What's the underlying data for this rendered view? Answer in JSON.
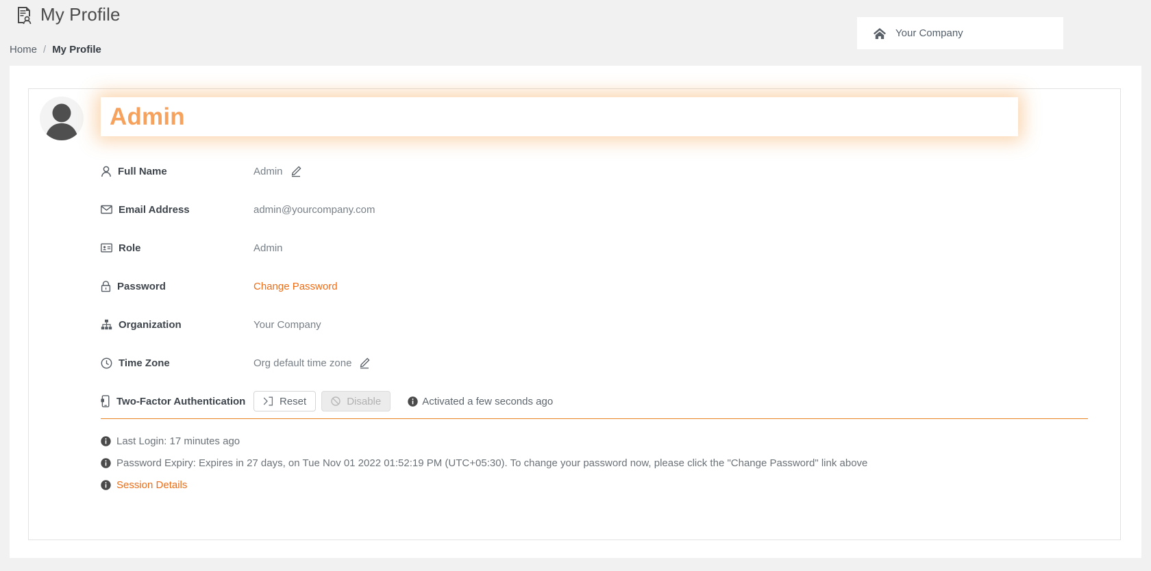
{
  "header": {
    "title": "My Profile",
    "icon": "document-user-icon"
  },
  "breadcrumb": {
    "home": "Home",
    "separator": "/",
    "current": "My Profile"
  },
  "company_badge": {
    "icon": "home-icon",
    "name": "Your Company"
  },
  "profile": {
    "avatar_icon": "user-avatar-icon",
    "display_name": "Admin",
    "fields": [
      {
        "icon": "person-icon",
        "label": "Full Name",
        "value": "Admin",
        "editable": true,
        "link": false
      },
      {
        "icon": "envelope-icon",
        "label": "Email Address",
        "value": "admin@yourcompany.com",
        "editable": false,
        "link": false
      },
      {
        "icon": "id-badge-icon",
        "label": "Role",
        "value": "Admin",
        "editable": false,
        "link": false
      },
      {
        "icon": "lock-icon",
        "label": "Password",
        "value": "Change Password",
        "editable": false,
        "link": true
      },
      {
        "icon": "sitemap-icon",
        "label": "Organization",
        "value": "Your Company",
        "editable": false,
        "link": false
      },
      {
        "icon": "clock-icon",
        "label": "Time Zone",
        "value": "Org default time zone",
        "editable": true,
        "link": false
      }
    ],
    "two_factor": {
      "icon": "mobile-lock-icon",
      "label": "Two-Factor Authentication",
      "reset_button": {
        "label": "Reset",
        "icon": "sign-out-icon",
        "enabled": true
      },
      "disable_button": {
        "label": "Disable",
        "icon": "ban-icon",
        "enabled": false
      },
      "status_icon": "info-icon",
      "status": "Activated a few seconds ago"
    },
    "notes": [
      {
        "icon": "info-icon",
        "text": "Last Login: 17 minutes ago",
        "link": false
      },
      {
        "icon": "info-icon",
        "text": "Password Expiry: Expires in 27 days, on Tue Nov 01 2022 01:52:19 PM (UTC+05:30). To change your password now, please click the \"Change Password\" link above",
        "link": false
      },
      {
        "icon": "info-icon",
        "text": "Session Details",
        "link": true
      }
    ]
  },
  "colors": {
    "accent_orange": "#ef6c15",
    "name_orange": "#f6a15c",
    "divider_orange": "#e8821e",
    "page_background": "#f1f1f1",
    "text_dark": "#3d444b",
    "text_muted": "#777f87"
  }
}
